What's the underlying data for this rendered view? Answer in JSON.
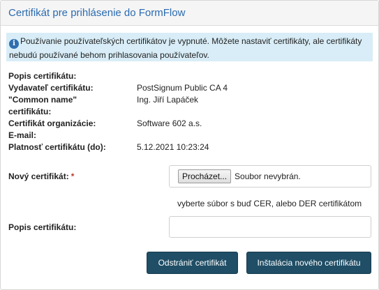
{
  "panel": {
    "title": "Certifikát pre prihlásenie do FormFlow"
  },
  "info": {
    "icon": "info-icon",
    "icon_glyph": "i",
    "text": "Používanie používateľských certifikátov je vypnuté. Môžete nastaviť certifikáty, ale certifikáty nebudú používané behom prihlasovania používateľov."
  },
  "details": [
    {
      "label": "Popis certifikátu:",
      "value": ""
    },
    {
      "label": "Vydavateľ certifikátu:",
      "value": "PostSignum Public CA 4"
    },
    {
      "label": "\"Common name\" certifikátu:",
      "value": "Ing. Jiří Lapáček"
    },
    {
      "label": "Certifikát organizácie:",
      "value": "Software 602 a.s."
    },
    {
      "label": "E-mail:",
      "value": ""
    },
    {
      "label": "Platnosť certifikátu (do):",
      "value": "5.12.2021 10:23:24"
    }
  ],
  "form": {
    "new_cert_label": "Nový certifikát:",
    "required_mark": "*",
    "browse_label": "Procházet...",
    "file_status": "Soubor nevybrán.",
    "hint": "vyberte súbor s buď CER, alebo DER certifikátom",
    "description_label": "Popis certifikátu:",
    "description_value": ""
  },
  "buttons": {
    "remove": "Odstrániť certifikát",
    "install": "Inštalácia nového certifikátu"
  },
  "colors": {
    "title": "#2a6bb0",
    "info_bg": "#d8edf7",
    "button_bg": "#1f4e66",
    "required": "#c0392b"
  }
}
